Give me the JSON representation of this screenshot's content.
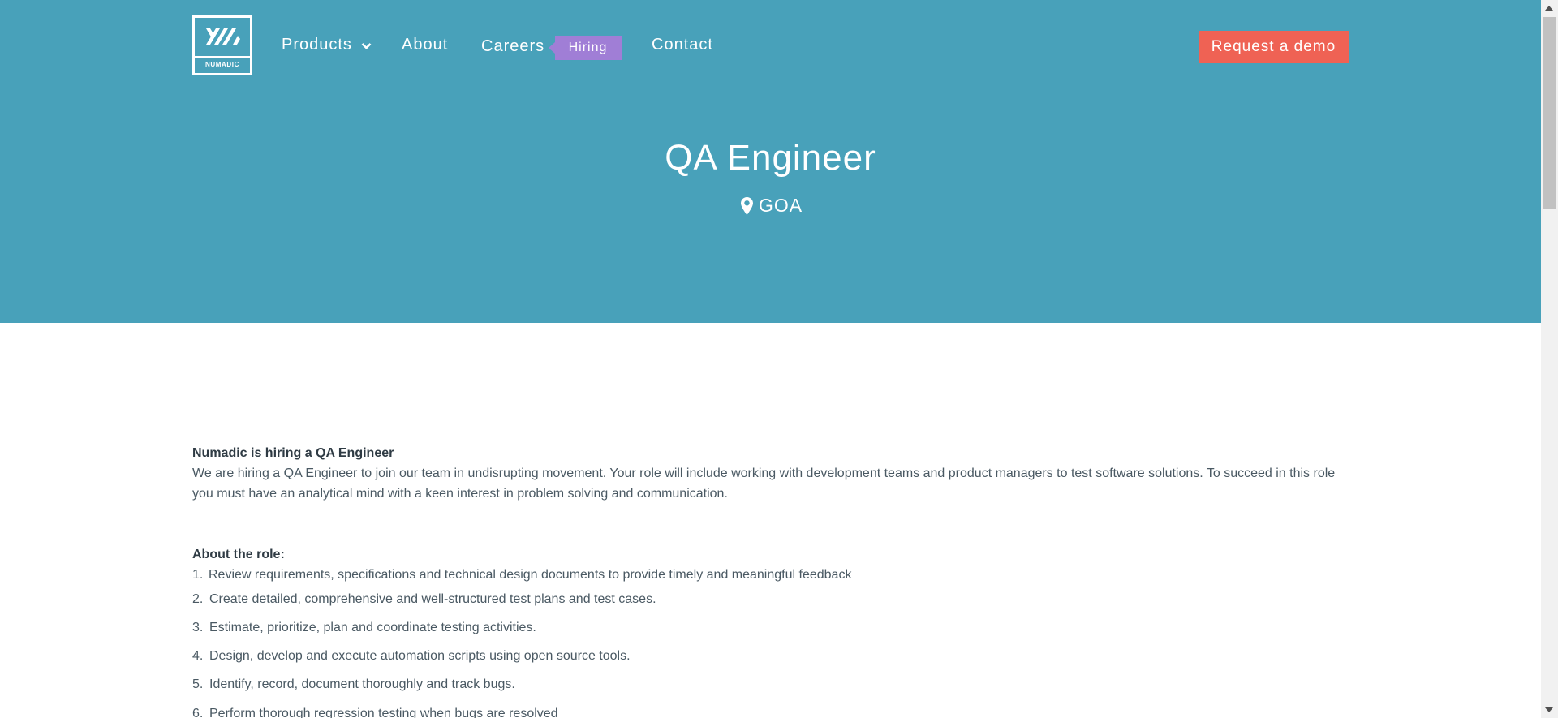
{
  "brand": {
    "logo_text": "NUMADIC",
    "colors": {
      "hero_bg": "#48a1ba",
      "cta": "#ef6254",
      "badge": "#a07ed6"
    }
  },
  "nav": {
    "products": "Products",
    "about": "About",
    "careers": "Careers",
    "hiring_badge": "Hiring",
    "contact": "Contact",
    "products_icon": "chevron-down-icon"
  },
  "header": {
    "cta": "Request a demo"
  },
  "hero": {
    "title": "QA Engineer",
    "location": "GOA",
    "location_icon": "map-pin-icon"
  },
  "content": {
    "intro_heading": "Numadic is hiring a QA Engineer",
    "intro_body": "We are hiring a QA Engineer to join our team in undisrupting movement. Your role will include working with development teams and product managers to test software solutions. To succeed in this role you must have an analytical mind with a keen interest in problem solving and communication.",
    "role_heading": "About the role:",
    "role_items": [
      {
        "num": "1.",
        "text": "Review requirements, specifications and technical design documents to provide timely and meaningful feedback"
      },
      {
        "num": "2.",
        "text": "Create detailed, comprehensive and well-structured test plans and test cases."
      },
      {
        "num": "3.",
        "text": "Estimate, prioritize, plan and coordinate testing activities."
      },
      {
        "num": "4.",
        "text": "Design, develop and execute automation scripts using open source tools."
      },
      {
        "num": "5.",
        "text": "Identify, record, document thoroughly and track bugs."
      },
      {
        "num": "6.",
        "text": "Perform thorough regression testing when bugs are resolved"
      }
    ]
  }
}
